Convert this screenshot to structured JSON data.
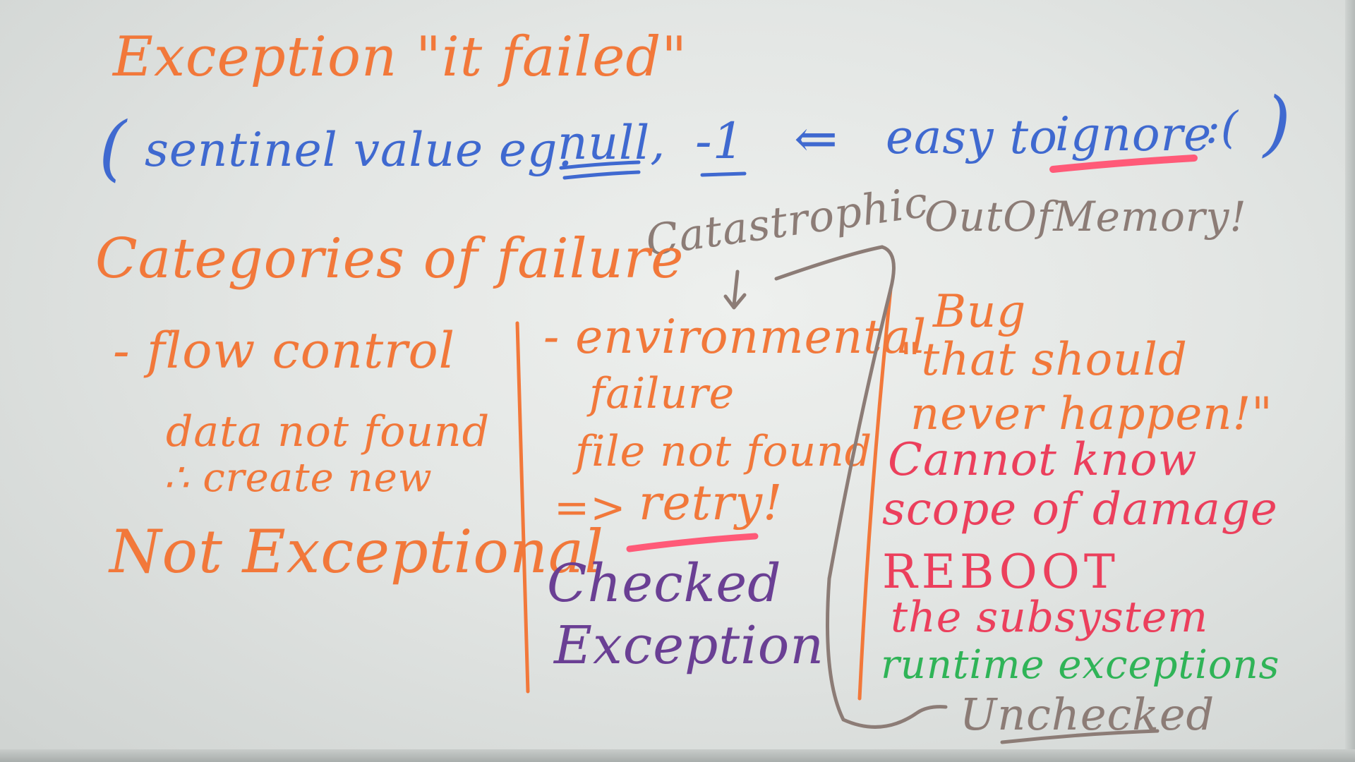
{
  "colors": {
    "orange": "#f2783a",
    "blue": "#3f69d0",
    "brown": "#8c7c76",
    "pink": "#ec3f5c",
    "purple": "#6a3f94",
    "green": "#2fb457"
  },
  "whiteboard": {
    "title": "Exception \"it failed\"",
    "sentinel": {
      "open_paren": "(",
      "text": "sentinel value eg.",
      "null": "null,",
      "minus_one": "-1",
      "arrow": "⇐",
      "easy_to": "easy to",
      "ignore": "ignore",
      "frown": ":(",
      "close_paren": ")"
    },
    "catastrophic": "Catastrophic",
    "out_of_memory": "OutOfMemory!",
    "categories_heading": "Categories of failure",
    "left_column": {
      "flow_control": "- flow control",
      "data_not_found": "data not found",
      "create_new": "∴ create new",
      "not_exceptional": "Not Exceptional"
    },
    "middle_column": {
      "environmental": "- environmental",
      "failure": "failure",
      "file_not_found": "file not found",
      "retry_arrow": "=>",
      "retry": "retry!",
      "checked": "Checked",
      "exception": "Exception"
    },
    "right_column": {
      "bug": "Bug",
      "should_never_1": "\"that should",
      "should_never_2": "never happen!\"",
      "cannot_know": "Cannot know",
      "scope_of_damage": "scope of damage",
      "reboot": "REBOOT",
      "subsystem": "the subsystem",
      "runtime_exceptions": "runtime exceptions",
      "unchecked": "Unchecked"
    }
  }
}
